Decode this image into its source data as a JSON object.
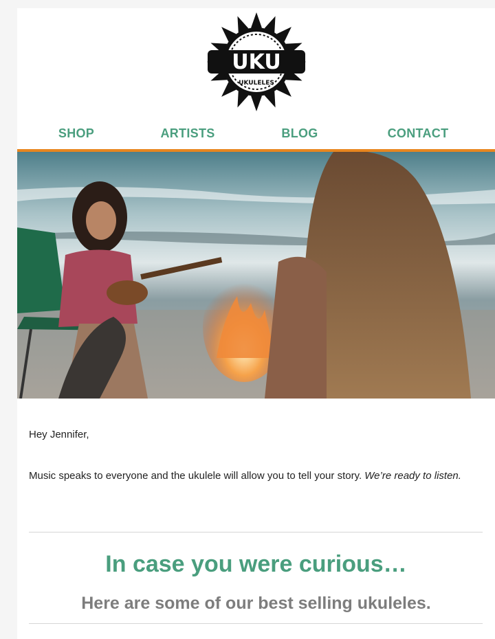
{
  "brand": {
    "logo_text": "UKU",
    "logo_subtext": "UKULELES"
  },
  "nav": {
    "items": [
      {
        "label": "SHOP"
      },
      {
        "label": "ARTISTS"
      },
      {
        "label": "BLOG"
      },
      {
        "label": "CONTACT"
      }
    ]
  },
  "colors": {
    "accent_green": "#4a9e7e",
    "accent_orange": "#e8861f",
    "subhead_gray": "#7d7d7d"
  },
  "hero": {
    "description_icon": "beach-bonfire-ukulele-photo"
  },
  "body": {
    "greeting": "Hey Jennifer,",
    "intro_text": "Music speaks to everyone and the ukulele will allow you to tell your story. ",
    "intro_emphasis": "We’re ready to listen."
  },
  "section": {
    "headline": "In case you were curious…",
    "subheadline": "Here are some of our best selling ukuleles."
  }
}
